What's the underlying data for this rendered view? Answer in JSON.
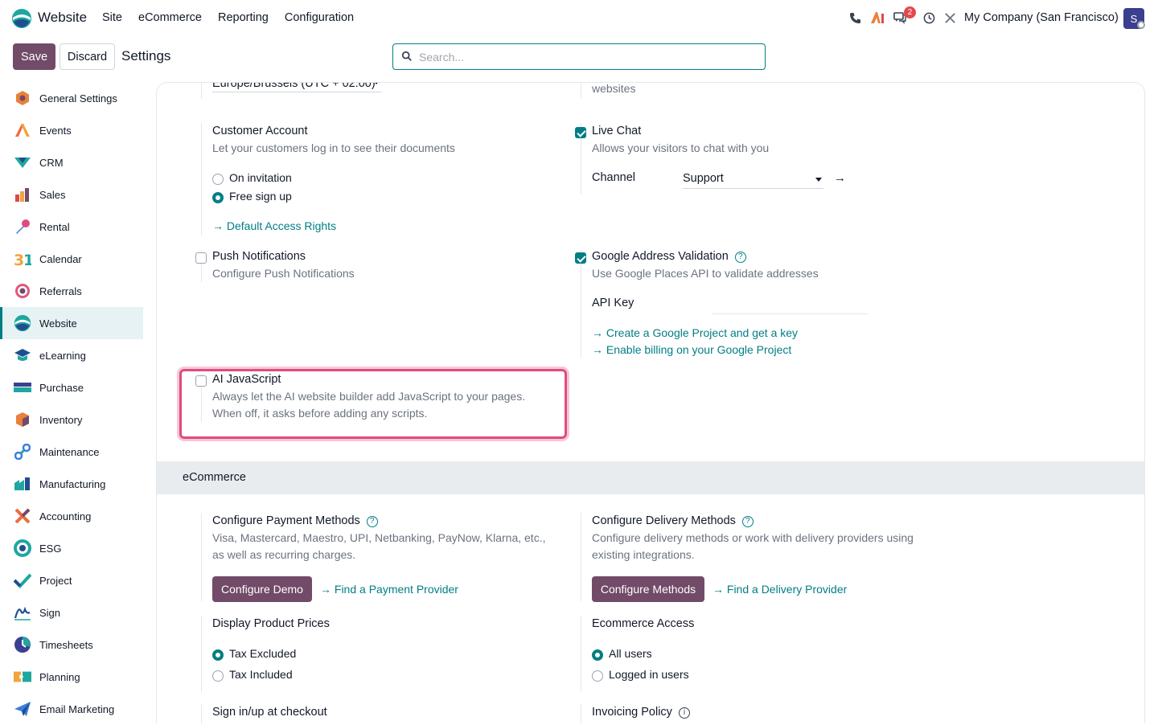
{
  "navbar": {
    "app_name": "Website",
    "menu": [
      "Site",
      "eCommerce",
      "Reporting",
      "Configuration"
    ],
    "company": "My Company (San Francisco)",
    "badge_count": "2",
    "avatar_letter": "S"
  },
  "control_panel": {
    "save_label": "Save",
    "discard_label": "Discard",
    "title": "Settings",
    "search_placeholder": "Search..."
  },
  "sidebar": {
    "items": [
      {
        "label": "General Settings",
        "icon": "general-settings-icon",
        "color": "#e8813b"
      },
      {
        "label": "Events",
        "icon": "events-icon",
        "color": "#f06a3c"
      },
      {
        "label": "CRM",
        "icon": "crm-icon",
        "color": "#1ea7a0"
      },
      {
        "label": "Sales",
        "icon": "sales-icon",
        "color": "#f0a43b"
      },
      {
        "label": "Rental",
        "icon": "rental-icon",
        "color": "#3c7de0"
      },
      {
        "label": "Calendar",
        "icon": "calendar-icon",
        "color": "#f0a43b"
      },
      {
        "label": "Referrals",
        "icon": "referrals-icon",
        "color": "#e0577b"
      },
      {
        "label": "Website",
        "icon": "website-icon",
        "color": "#1ea7a0"
      },
      {
        "label": "eLearning",
        "icon": "elearning-icon",
        "color": "#1ea7a0"
      },
      {
        "label": "Purchase",
        "icon": "purchase-icon",
        "color": "#714b67"
      },
      {
        "label": "Inventory",
        "icon": "inventory-icon",
        "color": "#e8813b"
      },
      {
        "label": "Maintenance",
        "icon": "maintenance-icon",
        "color": "#3c7de0"
      },
      {
        "label": "Manufacturing",
        "icon": "manufacturing-icon",
        "color": "#1ea7a0"
      },
      {
        "label": "Accounting",
        "icon": "accounting-icon",
        "color": "#f06a3c"
      },
      {
        "label": "ESG",
        "icon": "esg-icon",
        "color": "#1ea7a0"
      },
      {
        "label": "Project",
        "icon": "project-icon",
        "color": "#1ea7a0"
      },
      {
        "label": "Sign",
        "icon": "sign-icon",
        "color": "#1f4f8f"
      },
      {
        "label": "Timesheets",
        "icon": "timesheets-icon",
        "color": "#3b3f8f"
      },
      {
        "label": "Planning",
        "icon": "planning-icon",
        "color": "#f0a43b"
      },
      {
        "label": "Email Marketing",
        "icon": "email-marketing-icon",
        "color": "#3c7de0"
      }
    ],
    "active": "Website"
  },
  "settings": {
    "timezone_value": "Europe/Brussels (UTC + 02:00)",
    "websites_text": "websites",
    "customer_account": {
      "title": "Customer Account",
      "desc": "Let your customers log in to see their documents",
      "options": [
        "On invitation",
        "Free sign up"
      ],
      "selected": "Free sign up",
      "link": "Default Access Rights"
    },
    "live_chat": {
      "title": "Live Chat",
      "desc": "Allows your visitors to chat with you",
      "checked": true,
      "channel_label": "Channel",
      "channel_value": "Support"
    },
    "push_notifications": {
      "title": "Push Notifications",
      "desc": "Configure Push Notifications",
      "checked": false
    },
    "google_address": {
      "title": "Google Address Validation",
      "desc": "Use Google Places API to validate addresses",
      "checked": true,
      "api_key_label": "API Key",
      "api_key_value": "",
      "links": [
        "Create a Google Project and get a key",
        "Enable billing on your Google Project"
      ]
    },
    "ai_javascript": {
      "title": "AI JavaScript",
      "desc_line1": "Always let the AI website builder add JavaScript to your pages.",
      "desc_line2": "When off, it asks before adding any scripts.",
      "checked": false
    }
  },
  "ecommerce": {
    "section_title": "eCommerce",
    "payment": {
      "title": "Configure Payment Methods",
      "desc_line1": "Visa, Mastercard, Maestro, UPI, Netbanking, PayNow, Klarna, etc.,",
      "desc_line2": "as well as recurring charges.",
      "button": "Configure Demo",
      "link": "Find a Payment Provider"
    },
    "delivery": {
      "title": "Configure Delivery Methods",
      "desc_line1": "Configure delivery methods or work with delivery providers using",
      "desc_line2": "existing integrations.",
      "button": "Configure Methods",
      "link": "Find a Delivery Provider"
    },
    "prices": {
      "title": "Display Product Prices",
      "options": [
        "Tax Excluded",
        "Tax Included"
      ],
      "selected": "Tax Excluded"
    },
    "access": {
      "title": "Ecommerce Access",
      "options": [
        "All users",
        "Logged in users"
      ],
      "selected": "All users"
    },
    "signup_checkout": {
      "title": "Sign in/up at checkout"
    },
    "invoicing": {
      "title": "Invoicing Policy"
    }
  },
  "colors": {
    "brand": "#714b67",
    "accent": "#017e84",
    "highlight": "#e04a7f"
  }
}
